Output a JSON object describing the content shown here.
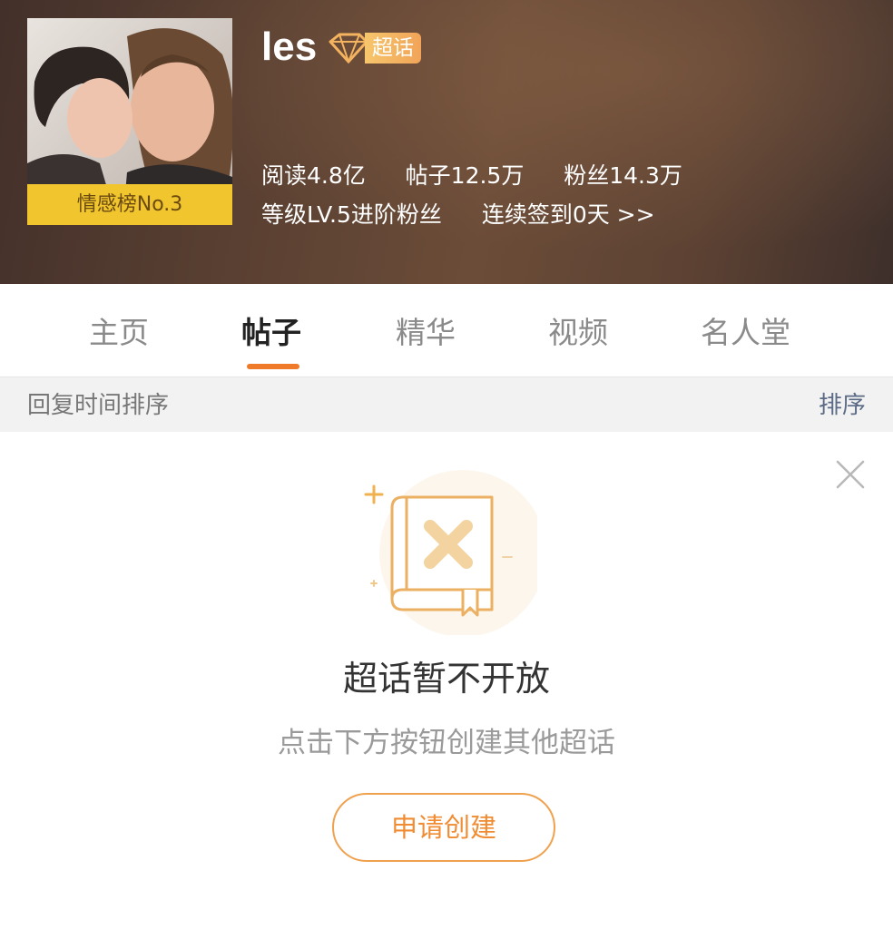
{
  "header": {
    "topic_name": "les",
    "super_tag": "超话",
    "rank_badge": "情感榜No.3",
    "stats": {
      "reads": "阅读4.8亿",
      "posts": "帖子12.5万",
      "fans": "粉丝14.3万",
      "level": "等级LV.5进阶粉丝",
      "checkin": "连续签到0天 >>"
    }
  },
  "tabs": [
    {
      "label": "主页",
      "active": false
    },
    {
      "label": "帖子",
      "active": true
    },
    {
      "label": "精华",
      "active": false
    },
    {
      "label": "视频",
      "active": false
    },
    {
      "label": "名人堂",
      "active": false
    }
  ],
  "sortbar": {
    "label": "回复时间排序",
    "button": "排序"
  },
  "empty_state": {
    "title": "超话暂不开放",
    "subtitle": "点击下方按钮创建其他超话",
    "button": "申请创建",
    "icons": [
      "close-icon",
      "book-x-icon"
    ]
  },
  "colors": {
    "accent": "#ee7a2a",
    "rank_badge_bg": "#f0c52d",
    "button_border": "#f0a14e"
  }
}
